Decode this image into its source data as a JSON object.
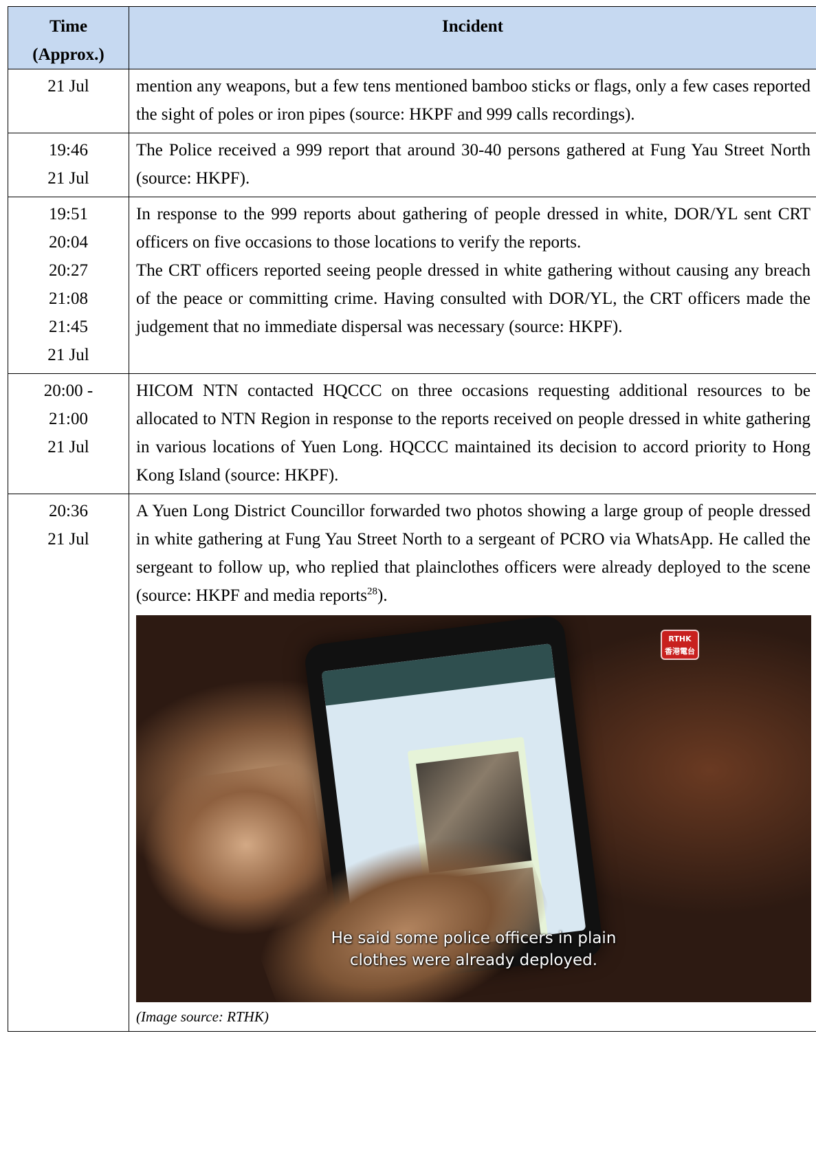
{
  "header": {
    "time_line1": "Time",
    "time_line2": "(Approx.)",
    "incident": "Incident"
  },
  "rows": [
    {
      "times": [
        "21 Jul"
      ],
      "text": "mention any weapons, but a few tens mentioned bamboo sticks or flags, only a few cases reported the sight of poles or iron pipes (source: HKPF and 999 calls recordings)."
    },
    {
      "times": [
        "19:46",
        "21 Jul"
      ],
      "text": "The Police received a 999 report that around 30-40 persons gathered at Fung Yau Street North (source: HKPF)."
    },
    {
      "times": [
        "19:51",
        "20:04",
        "20:27",
        "21:08",
        "21:45",
        "21 Jul"
      ],
      "text": "In response to the 999 reports about gathering of people dressed in white, DOR/YL sent CRT officers on five occasions to those locations to verify the reports.",
      "text2": "The CRT officers reported seeing people dressed in white gathering without causing any breach of the peace or committing crime.   Having consulted with DOR/YL, the CRT officers made the judgement that no immediate dispersal was necessary (source: HKPF)."
    },
    {
      "times": [
        "20:00 -",
        "21:00",
        "21 Jul"
      ],
      "text": "HICOM NTN contacted HQCCC on three occasions requesting additional resources to be allocated to NTN Region in response to the reports received on people dressed in white gathering in various locations of Yuen Long.   HQCCC maintained its decision to accord priority to Hong Kong Island (source: HKPF)."
    },
    {
      "times": [
        "20:36",
        "21 Jul"
      ],
      "text": "A Yuen Long District Councillor forwarded two photos showing a large group of people dressed in white gathering at Fung Yau Street North to a sergeant of PCRO via WhatsApp.   He called the sergeant to follow up, who replied that plainclothes officers were already deployed to the scene (source: HKPF and media reports",
      "footnote": "28",
      "text_tail": ").",
      "image": {
        "logo_line1": "RTHK",
        "logo_line2": "香港電台",
        "subtitle_line1": "He said some police officers in plain",
        "subtitle_line2": "clothes were already deployed.",
        "caption": "(Image source: RTHK)"
      }
    }
  ]
}
